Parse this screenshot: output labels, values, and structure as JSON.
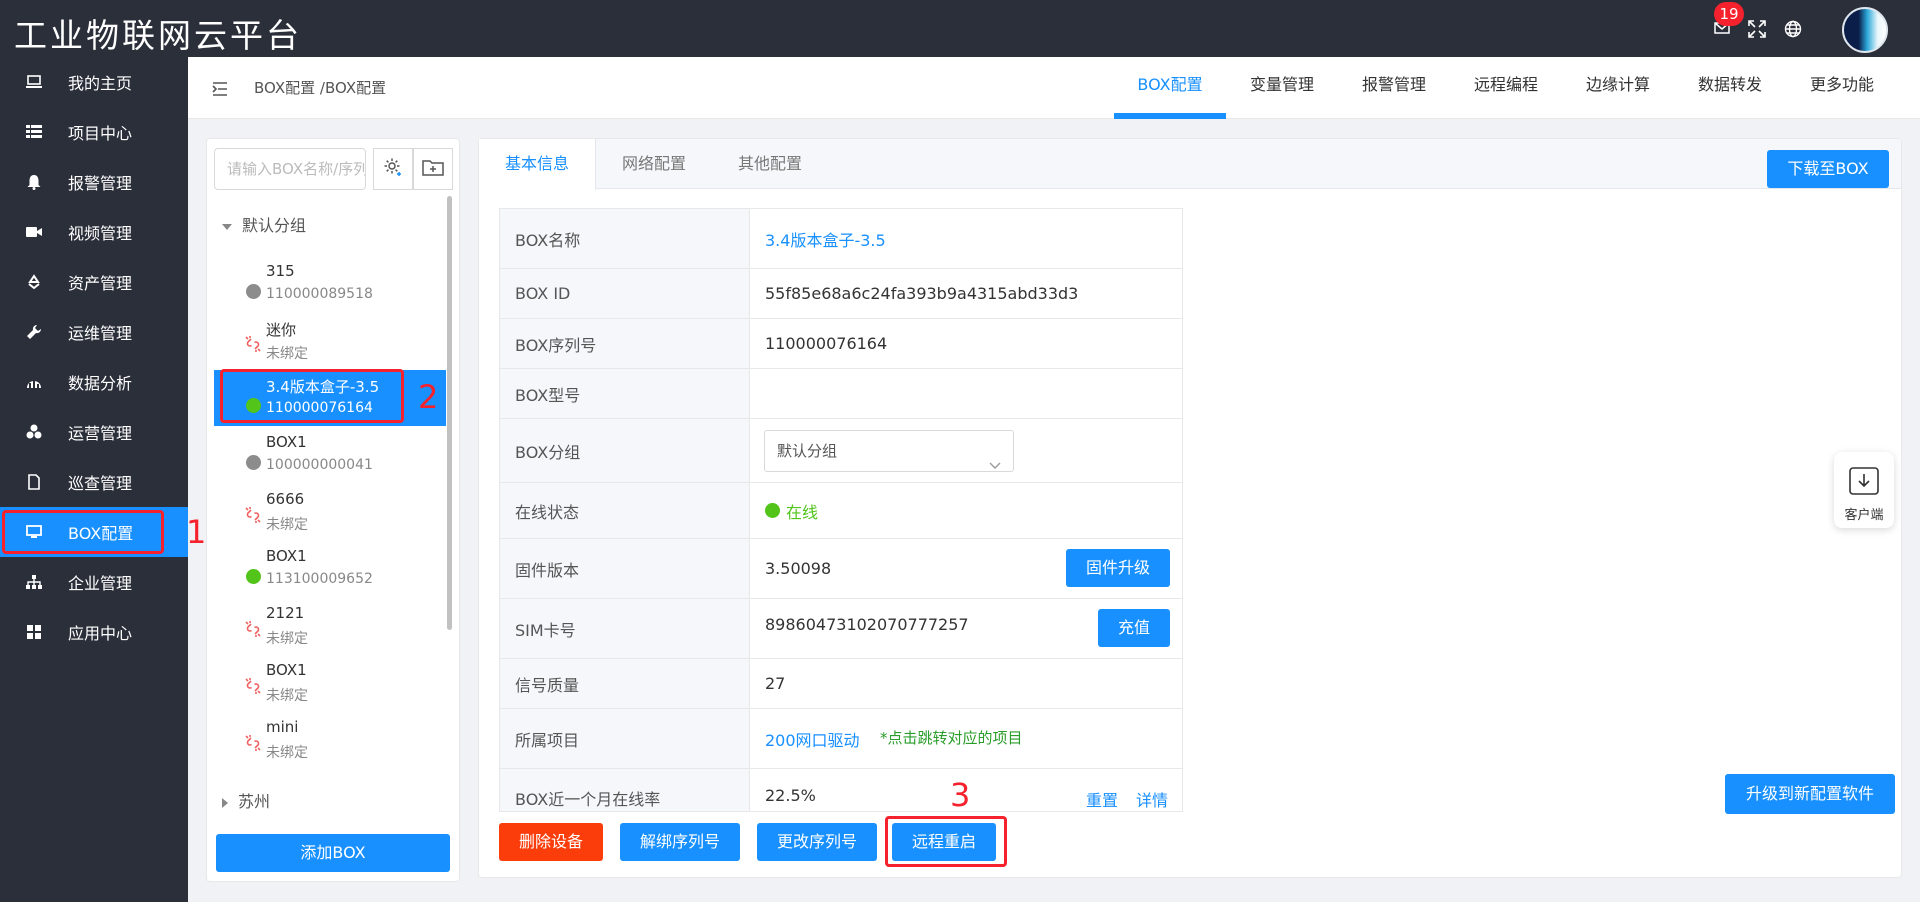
{
  "app": {
    "title": "工业物联网云平台",
    "badge_count": "19"
  },
  "sidebar": {
    "items": [
      {
        "label": "我的主页",
        "icon": "monitor-icon"
      },
      {
        "label": "项目中心",
        "icon": "list-icon"
      },
      {
        "label": "报警管理",
        "icon": "bell-icon"
      },
      {
        "label": "视频管理",
        "icon": "video-icon"
      },
      {
        "label": "资产管理",
        "icon": "recycle-icon"
      },
      {
        "label": "运维管理",
        "icon": "wrench-icon"
      },
      {
        "label": "数据分析",
        "icon": "chart-icon"
      },
      {
        "label": "运营管理",
        "icon": "cubes-icon"
      },
      {
        "label": "巡查管理",
        "icon": "file-icon"
      },
      {
        "label": "BOX配置",
        "icon": "desktop-icon",
        "active": true
      },
      {
        "label": "企业管理",
        "icon": "org-icon"
      },
      {
        "label": "应用中心",
        "icon": "grid-icon"
      }
    ]
  },
  "header": {
    "breadcrumb": "BOX配置 /BOX配置",
    "tabs": [
      "BOX配置",
      "变量管理",
      "报警管理",
      "远程编程",
      "边缘计算",
      "数据转发",
      "更多功能"
    ]
  },
  "tree": {
    "search_placeholder": "请输入BOX名称/序列号",
    "groups": [
      "默认分组",
      "苏州"
    ],
    "nodes": [
      {
        "name": "315",
        "sub": "110000089518",
        "status": "offline"
      },
      {
        "name": "迷你",
        "sub": "未绑定",
        "status": "unbound"
      },
      {
        "name": "3.4版本盒子-3.5",
        "sub": "110000076164",
        "status": "online",
        "active": true
      },
      {
        "name": "BOX1",
        "sub": "100000000041",
        "status": "offline"
      },
      {
        "name": "6666",
        "sub": "未绑定",
        "status": "unbound"
      },
      {
        "name": "BOX1",
        "sub": "113100009652",
        "status": "online"
      },
      {
        "name": "2121",
        "sub": "未绑定",
        "status": "unbound"
      },
      {
        "name": "BOX1",
        "sub": "未绑定",
        "status": "unbound"
      },
      {
        "name": "mini",
        "sub": "未绑定",
        "status": "unbound"
      }
    ],
    "add_button": "添加BOX"
  },
  "main": {
    "tabs": [
      "基本信息",
      "网络配置",
      "其他配置"
    ],
    "download_button": "下载至BOX",
    "upgrade_software_button": "升级到新配置软件",
    "client_label": "客户端",
    "info": {
      "box_name_label": "BOX名称",
      "box_name": "3.4版本盒子-3.5",
      "box_id_label": "BOX ID",
      "box_id": "55f85e68a6c24fa393b9a4315abd33d3",
      "serial_label": "BOX序列号",
      "serial": "110000076164",
      "model_label": "BOX型号",
      "model": "",
      "group_label": "BOX分组",
      "group": "默认分组",
      "status_label": "在线状态",
      "status": "在线",
      "firmware_label": "固件版本",
      "firmware": "3.50098",
      "firmware_button": "固件升级",
      "sim_label": "SIM卡号",
      "sim": "89860473102070777257",
      "sim_button": "充值",
      "signal_label": "信号质量",
      "signal": "27",
      "project_label": "所属项目",
      "project": "200网口驱动",
      "project_note": "*点击跳转对应的项目",
      "online_rate_label": "BOX近一个月在线率",
      "online_rate": "22.5%",
      "reset_link": "重置",
      "detail_link": "详情"
    },
    "actions": {
      "delete": "删除设备",
      "unbind": "解绑序列号",
      "change": "更改序列号",
      "reboot": "远程重启"
    }
  },
  "annotations": {
    "n1": "1",
    "n2": "2",
    "n3": "3"
  },
  "colors": {
    "primary": "#1890ff",
    "sidebar_bg": "#2b2f3a",
    "danger": "#fa3d0b",
    "annotation": "#f5222d",
    "online": "#52c41a"
  }
}
